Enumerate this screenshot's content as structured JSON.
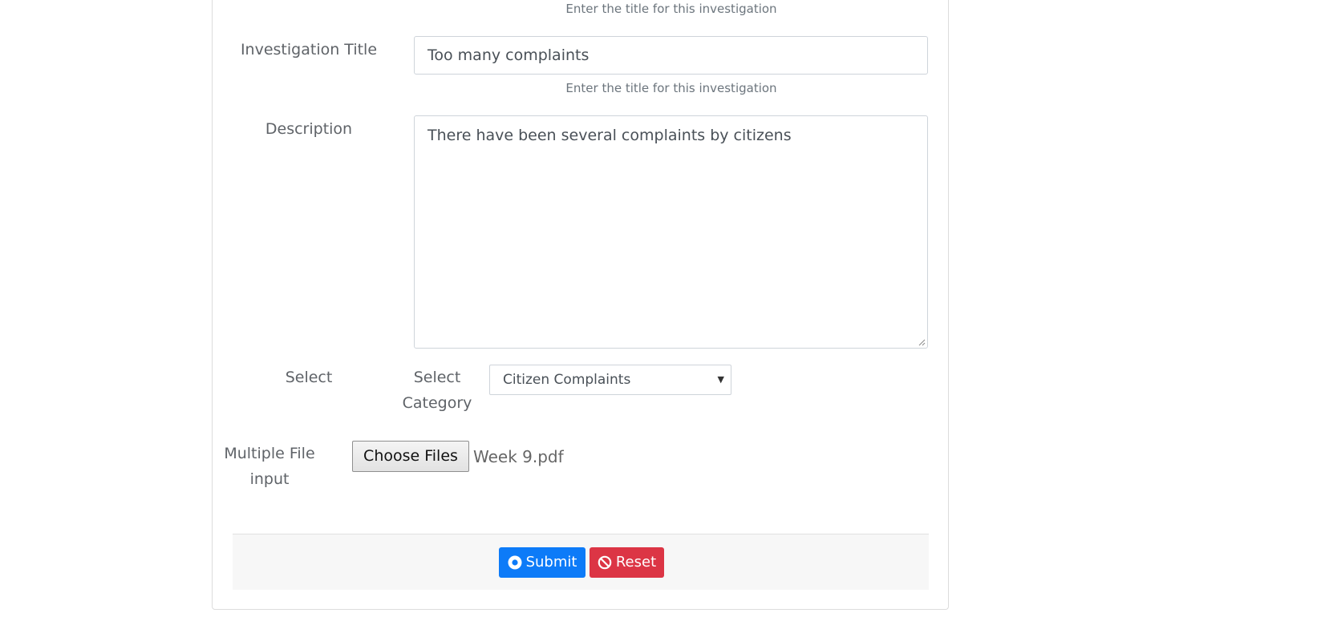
{
  "form": {
    "hint_top": "Enter the title for this investigation",
    "title_label": "Investigation Title",
    "title_value": "Too many complaints",
    "title_hint": "Enter the title for this investigation",
    "description_label": "Description",
    "description_value": "There have been several complaints by citizens",
    "select_label": "Select",
    "category_label": "Select Category",
    "category_value": "Citizen Complaints",
    "file_label": "Multiple File input",
    "file_button": "Choose Files",
    "file_name": "Week 9.pdf"
  },
  "actions": {
    "submit_label": "Submit",
    "reset_label": "Reset",
    "submit_color": "#0d7bf8",
    "reset_color": "#dc3545"
  },
  "icons": {
    "submit_icon": "dot-circle-icon",
    "reset_icon": "ban-icon"
  }
}
